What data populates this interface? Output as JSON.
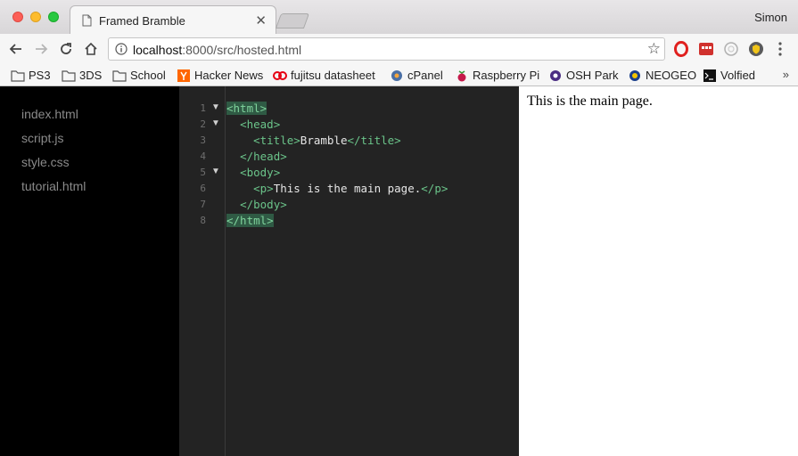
{
  "window": {
    "tab_title": "Framed Bramble",
    "tab_close": "✕",
    "profile": "Simon"
  },
  "toolbar": {
    "url_host": "localhost",
    "url_path": ":8000/src/hosted.html",
    "back_icon": "←",
    "forward_icon": "→",
    "reload_icon": "↻",
    "home_icon": "⌂",
    "star_icon": "☆"
  },
  "bookmarks": [
    {
      "label": "PS3",
      "icon": "folder-icon"
    },
    {
      "label": "3DS",
      "icon": "folder-icon"
    },
    {
      "label": "School",
      "icon": "folder-icon"
    },
    {
      "label": "Hacker News",
      "icon": "hacker-news-icon"
    },
    {
      "label": "fujitsu datasheet",
      "icon": "fujitsu-icon"
    },
    {
      "label": "cPanel",
      "icon": "cpanel-icon"
    },
    {
      "label": "Raspberry Pi",
      "icon": "raspberry-pi-icon"
    },
    {
      "label": "OSH Park",
      "icon": "osh-park-icon"
    },
    {
      "label": "NEOGEO",
      "icon": "neogeo-icon"
    },
    {
      "label": "Volfied",
      "icon": "terminal-icon"
    }
  ],
  "bookmarks_more": "»",
  "files": [
    "index.html",
    "script.js",
    "style.css",
    "tutorial.html"
  ],
  "editor": {
    "line_numbers": [
      "1",
      "2",
      "3",
      "4",
      "5",
      "6",
      "7",
      "8"
    ],
    "fold_marker": "▼",
    "lines": [
      {
        "indent": "",
        "open": "<html>",
        "text": "",
        "close": ""
      },
      {
        "indent": "  ",
        "open": "<head>",
        "text": "",
        "close": ""
      },
      {
        "indent": "    ",
        "open": "<title>",
        "text": "Bramble",
        "close": "</title>"
      },
      {
        "indent": "  ",
        "open": "</head>",
        "text": "",
        "close": ""
      },
      {
        "indent": "  ",
        "open": "<body>",
        "text": "",
        "close": ""
      },
      {
        "indent": "    ",
        "open": "<p>",
        "text": "This is the main page.",
        "close": "</p>"
      },
      {
        "indent": "  ",
        "open": "</body>",
        "text": "",
        "close": ""
      },
      {
        "indent": "",
        "open": "</html>",
        "text": "",
        "close": ""
      }
    ]
  },
  "preview": {
    "text": "This is the main page."
  },
  "colors": {
    "tag": "#6bc48a",
    "tag_highlight_bg": "#2f5a44",
    "editor_bg": "#232323",
    "file_panel_bg": "#000000"
  }
}
